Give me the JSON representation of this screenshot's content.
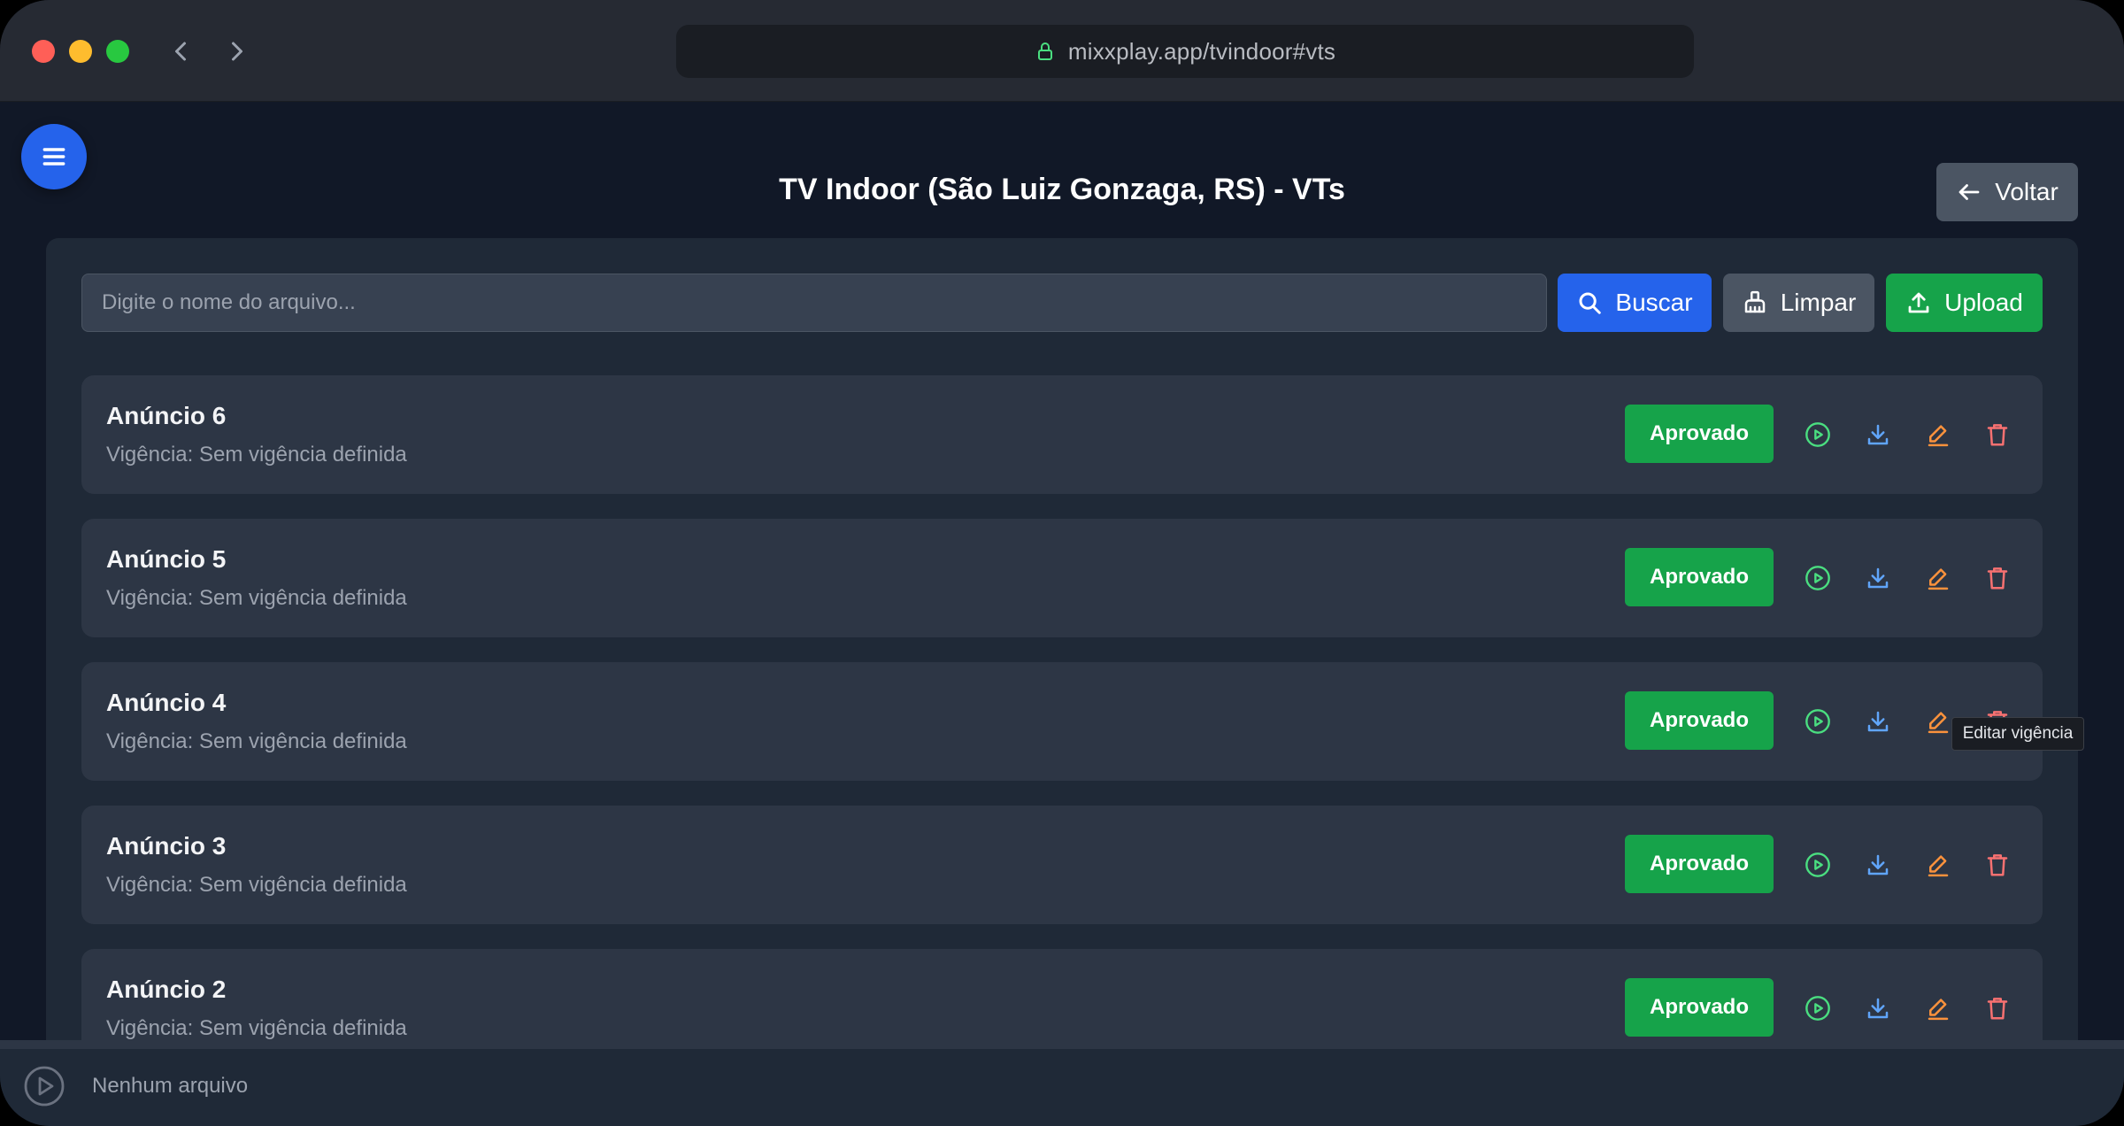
{
  "browser": {
    "url": "mixxplay.app/tvindoor#vts"
  },
  "header": {
    "title": "TV Indoor (São Luiz Gonzaga, RS) - VTs",
    "back_label": "Voltar"
  },
  "toolbar": {
    "search_placeholder": "Digite o nome do arquivo...",
    "search_label": "Buscar",
    "clear_label": "Limpar",
    "upload_label": "Upload"
  },
  "items": [
    {
      "title": "Anúncio 6",
      "subtitle": "Vigência: Sem vigência definida",
      "status": "Aprovado"
    },
    {
      "title": "Anúncio 5",
      "subtitle": "Vigência: Sem vigência definida",
      "status": "Aprovado"
    },
    {
      "title": "Anúncio 4",
      "subtitle": "Vigência: Sem vigência definida",
      "status": "Aprovado"
    },
    {
      "title": "Anúncio 3",
      "subtitle": "Vigência: Sem vigência definida",
      "status": "Aprovado"
    },
    {
      "title": "Anúncio 2",
      "subtitle": "Vigência: Sem vigência definida",
      "status": "Aprovado"
    }
  ],
  "tooltip": {
    "text": "Editar vigência"
  },
  "player": {
    "status_text": "Nenhum arquivo"
  },
  "icons": {
    "menu": "hamburger-icon",
    "back": "arrow-left-icon",
    "search": "magnifier-icon",
    "clear": "broom-icon",
    "upload": "upload-icon",
    "play": "play-circle-icon",
    "download": "download-icon",
    "edit": "pencil-icon",
    "delete": "trash-icon",
    "lock": "lock-icon"
  },
  "colors": {
    "primary": "#2563eb",
    "success": "#16a34a",
    "neutral_button": "#4b5563",
    "play_icon": "#4ade80",
    "download_icon": "#60a5fa",
    "edit_icon": "#fb923c",
    "delete_icon": "#f87171",
    "lock_icon": "#4ade80"
  }
}
